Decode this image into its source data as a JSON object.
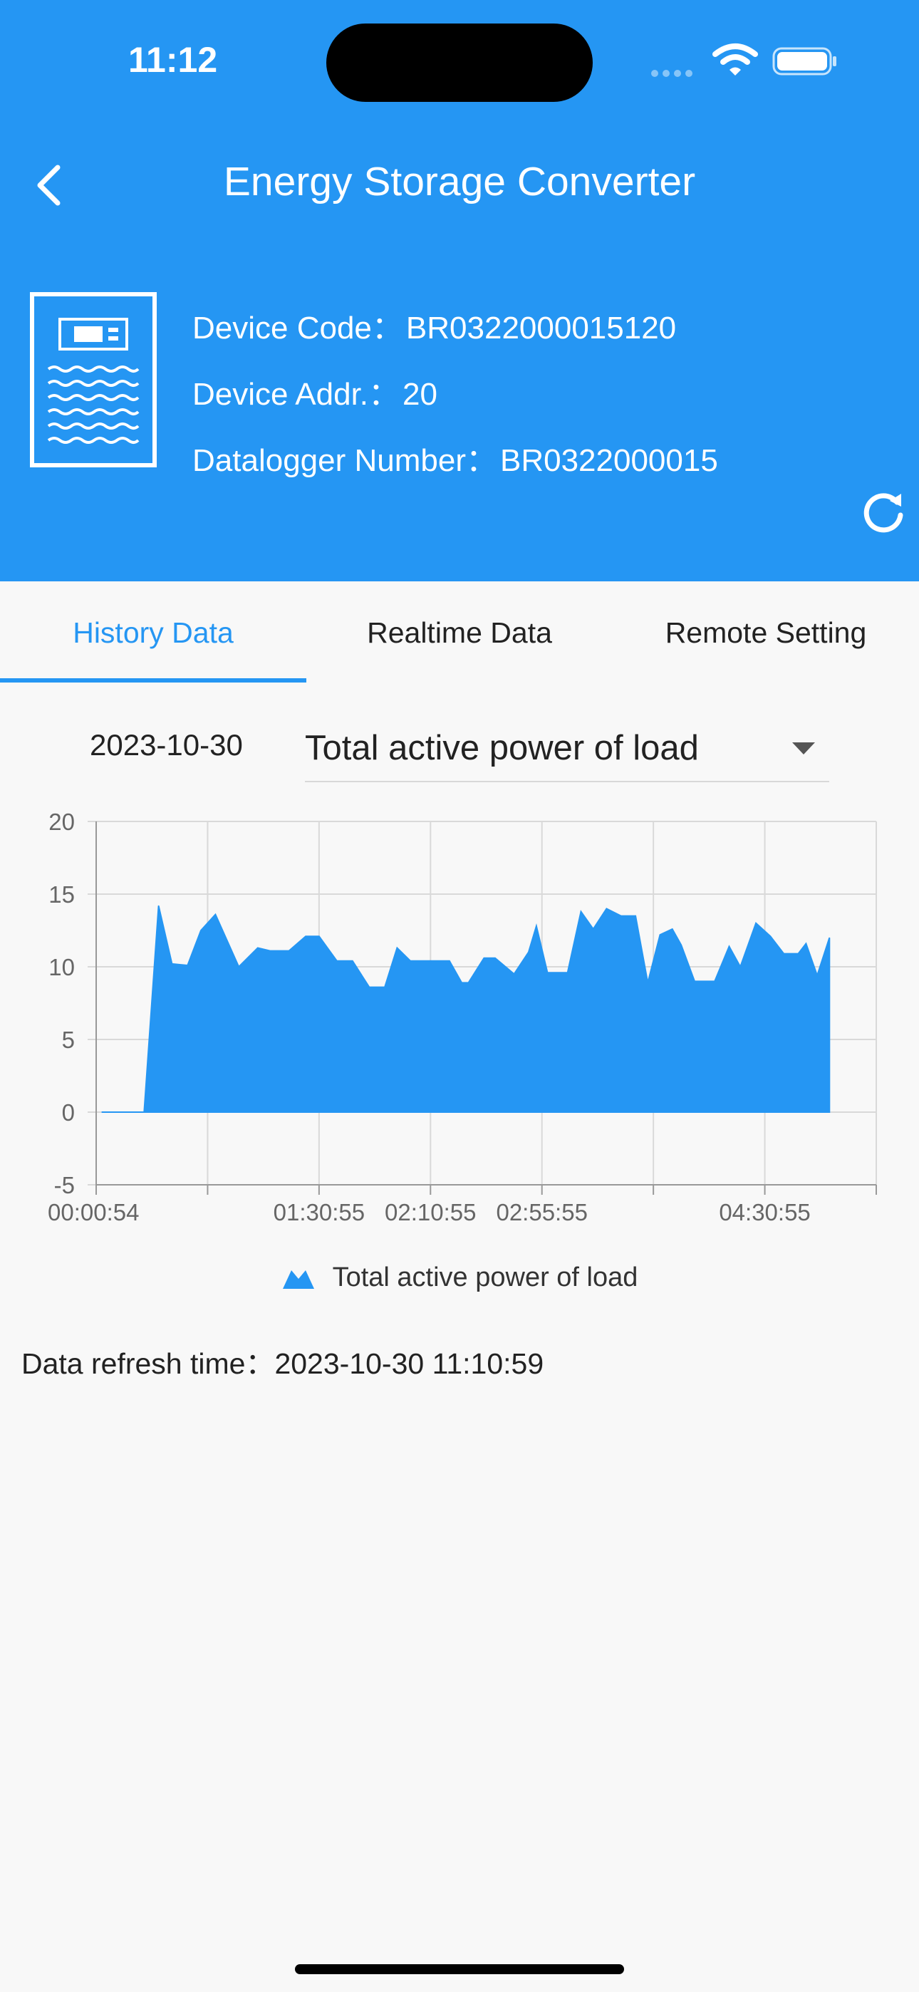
{
  "status_bar": {
    "time": "11:12"
  },
  "header": {
    "title": "Energy Storage Converter",
    "device_code_label": "Device Code：",
    "device_code_value": "BR0322000015120",
    "device_addr_label": "Device Addr.：",
    "device_addr_value": "20",
    "datalogger_label": "Datalogger Number：",
    "datalogger_value": "BR0322000015"
  },
  "tabs": [
    {
      "label": "History Data",
      "active": true
    },
    {
      "label": "Realtime Data",
      "active": false
    },
    {
      "label": "Remote Setting",
      "active": false
    }
  ],
  "filters": {
    "date": "2023-10-30",
    "metric": "Total active power of load"
  },
  "colors": {
    "accent": "#2596f3",
    "grid": "#d9d9d9"
  },
  "icons": [
    "back-arrow-icon",
    "device-cabinet-icon",
    "refresh-icon",
    "wifi-icon",
    "battery-icon",
    "dropdown-caret-icon",
    "area-legend-icon"
  ],
  "chart_data": {
    "type": "area",
    "title": "",
    "xlabel": "",
    "ylabel": "",
    "ylim": [
      -5,
      20
    ],
    "yticks": [
      20,
      15,
      10,
      5,
      0,
      -5
    ],
    "x_tick_labels": [
      "00:00:54",
      "01:30:55",
      "02:10:55",
      "02:55:55",
      "04:30:55"
    ],
    "x_tick_positions": [
      0,
      2,
      3,
      4,
      6
    ],
    "x_slots": 7,
    "grid": true,
    "legend_position": "bottom-center",
    "series": [
      {
        "name": "Total active power of load",
        "x": [
          0.05,
          0.43,
          0.56,
          0.68,
          0.82,
          0.94,
          1.07,
          1.28,
          1.45,
          1.56,
          1.73,
          1.88,
          2.0,
          2.16,
          2.3,
          2.45,
          2.59,
          2.7,
          2.82,
          2.99,
          3.04,
          3.17,
          3.28,
          3.34,
          3.48,
          3.58,
          3.75,
          3.88,
          3.95,
          4.05,
          4.23,
          4.35,
          4.46,
          4.58,
          4.71,
          4.8,
          4.84,
          4.95,
          5.06,
          5.17,
          5.25,
          5.37,
          5.55,
          5.68,
          5.78,
          5.92,
          6.05,
          6.17,
          6.3,
          6.37,
          6.47,
          6.58
        ],
        "values": [
          0,
          0,
          14.2,
          10.2,
          10.1,
          12.5,
          13.6,
          10.0,
          11.3,
          11.1,
          11.1,
          12.1,
          12.1,
          10.4,
          10.4,
          8.6,
          8.6,
          11.3,
          10.4,
          10.4,
          10.4,
          10.4,
          8.9,
          8.9,
          10.6,
          10.6,
          9.5,
          11.0,
          12.8,
          9.6,
          9.6,
          13.8,
          12.6,
          14.0,
          13.5,
          13.5,
          13.5,
          8.9,
          12.2,
          12.6,
          11.5,
          9.0,
          9.0,
          11.4,
          10.0,
          13.0,
          12.1,
          10.9,
          10.9,
          11.6,
          9.4,
          12.0
        ]
      }
    ]
  },
  "footer": {
    "refresh_label": "Data refresh time：",
    "refresh_value": "2023-10-30 11:10:59"
  }
}
